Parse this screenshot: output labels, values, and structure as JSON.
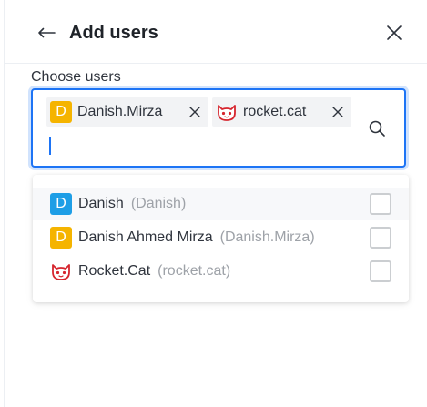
{
  "header": {
    "title": "Add users",
    "back_icon": "back-arrow-icon",
    "close_icon": "close-icon"
  },
  "field": {
    "label": "Choose users",
    "search_icon": "search-icon",
    "value": ""
  },
  "selected_users": [
    {
      "avatar_letter": "D",
      "avatar_color": "#f5b400",
      "label": "Danish.Mirza"
    },
    {
      "avatar_icon": "rocket-cat-avatar-icon",
      "label": "rocket.cat"
    }
  ],
  "options": [
    {
      "avatar_letter": "D",
      "avatar_color": "#1e9ee6",
      "name": "Danish",
      "username": "(Danish)",
      "checked": false
    },
    {
      "avatar_letter": "D",
      "avatar_color": "#f5b400",
      "name": "Danish Ahmed Mirza",
      "username": "(Danish.Mirza)",
      "checked": false
    },
    {
      "avatar_icon": "rocket-cat-avatar-icon",
      "name": "Rocket.Cat",
      "username": "(rocket.cat)",
      "checked": false
    }
  ],
  "colors": {
    "accent": "#1d74f5",
    "chip_bg": "#f2f3f5",
    "muted_text": "#9ea2a8",
    "rocket_cat_red": "#d6252e"
  }
}
